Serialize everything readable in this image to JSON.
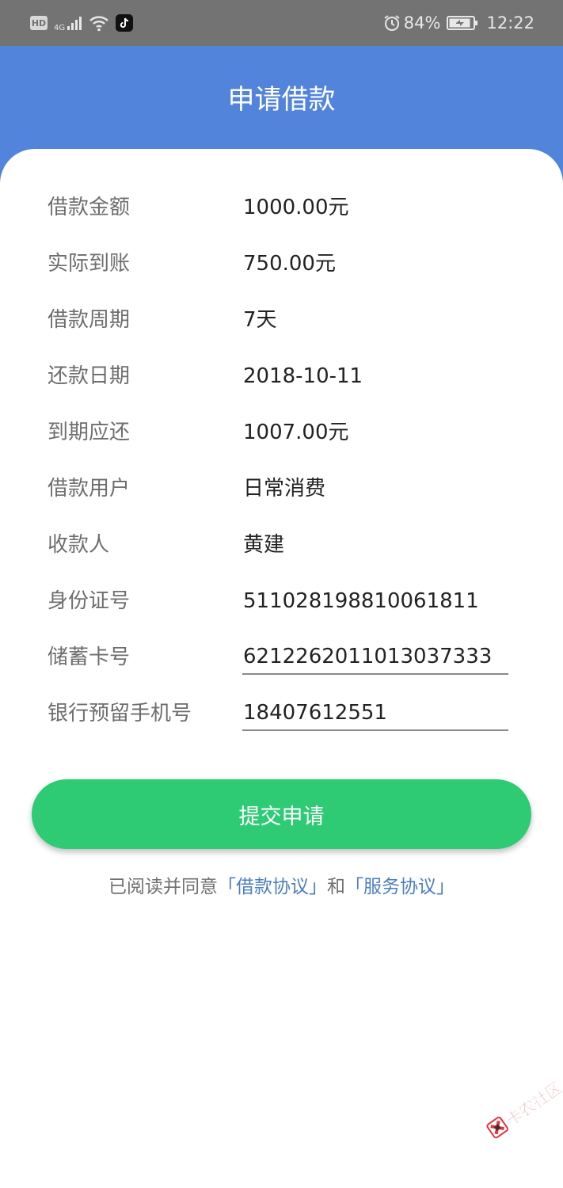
{
  "status_bar": {
    "hd_badge": "HD",
    "network_type": "4G",
    "battery_percent": "84%",
    "time": "12:22",
    "icons": [
      "hd-icon",
      "signal-icon",
      "wifi-icon",
      "tiktok-icon",
      "alarm-icon",
      "battery-charging-icon"
    ]
  },
  "header": {
    "title": "申请借款"
  },
  "details": [
    {
      "label": "借款金额",
      "value": "1000.00元"
    },
    {
      "label": "实际到账",
      "value": "750.00元"
    },
    {
      "label": "借款周期",
      "value": "7天"
    },
    {
      "label": "还款日期",
      "value": "2018-10-11"
    },
    {
      "label": "到期应还",
      "value": "1007.00元"
    },
    {
      "label": "借款用户",
      "value": "日常消费"
    },
    {
      "label": "收款人",
      "value": "黄建"
    },
    {
      "label": "身份证号",
      "value": "511028198810061811"
    }
  ],
  "inputs": {
    "card_label": "储蓄卡号",
    "card_value": "6212262011013037333",
    "phone_label": "银行预留手机号",
    "phone_value": "18407612551"
  },
  "submit": {
    "label": "提交申请"
  },
  "agreement": {
    "prefix": "已阅读并同意",
    "loan_link": "「借款协议」",
    "connector": "和",
    "service_link": "「服务协议」"
  },
  "watermark": {
    "text": "卡农社区"
  },
  "colors": {
    "header_bg": "#5284dc",
    "status_bar_bg": "#737373",
    "submit_bg": "#2ecb74",
    "link": "#4c7fc2",
    "label": "#6e6e6e",
    "value": "#222222"
  }
}
